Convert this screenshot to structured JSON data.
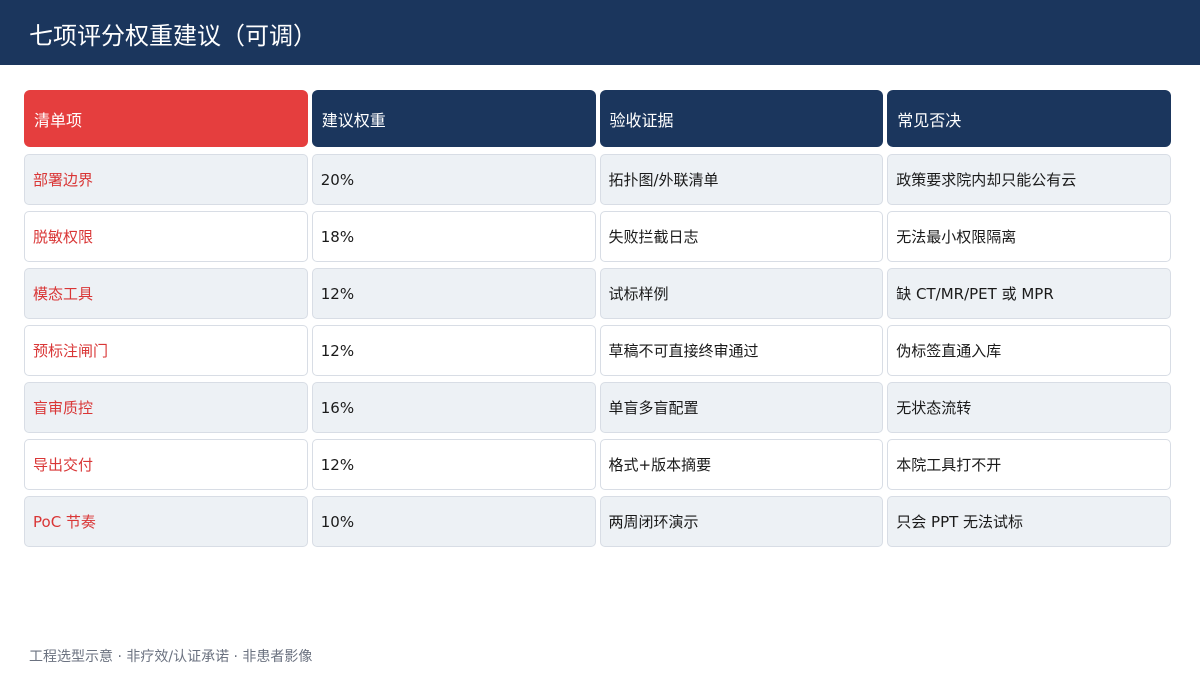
{
  "page": {
    "title": "七项评分权重建议（可调）",
    "footer": "工程选型示意 · 非疗效/认证承诺 · 非患者影像"
  },
  "table": {
    "headers": [
      "清单项",
      "建议权重",
      "验收证据",
      "常见否决"
    ],
    "rows": [
      {
        "item": "部署边界",
        "weight": "20%",
        "evidence": "拓扑图/外联清单",
        "veto": "政策要求院内却只能公有云"
      },
      {
        "item": "脱敏权限",
        "weight": "18%",
        "evidence": "失败拦截日志",
        "veto": "无法最小权限隔离"
      },
      {
        "item": "模态工具",
        "weight": "12%",
        "evidence": "试标样例",
        "veto": "缺 CT/MR/PET 或 MPR"
      },
      {
        "item": "预标注闸门",
        "weight": "12%",
        "evidence": "草稿不可直接终审通过",
        "veto": "伪标签直通入库"
      },
      {
        "item": "盲审质控",
        "weight": "16%",
        "evidence": "单盲多盲配置",
        "veto": "无状态流转"
      },
      {
        "item": "导出交付",
        "weight": "12%",
        "evidence": "格式+版本摘要",
        "veto": "本院工具打不开"
      },
      {
        "item": "PoC 节奏",
        "weight": "10%",
        "evidence": "两周闭环演示",
        "veto": "只会 PPT 无法试标"
      }
    ]
  },
  "colors": {
    "header_bar": "#1b365d",
    "accent_red": "#e53e3e",
    "row_shade": "#edf1f5"
  }
}
